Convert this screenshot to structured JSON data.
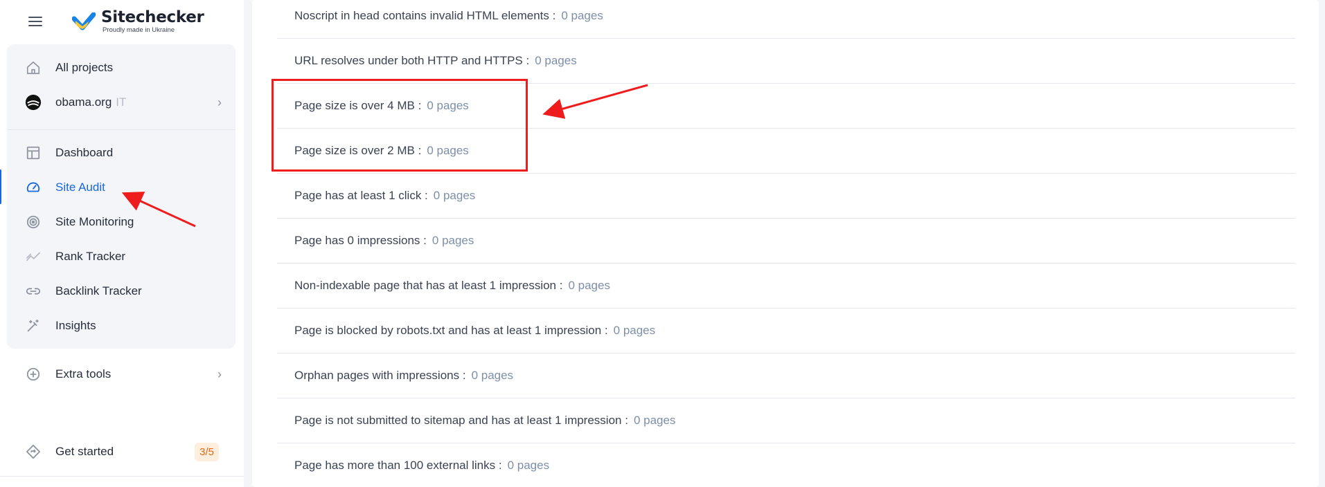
{
  "app": {
    "name": "Sitechecker",
    "tagline": "Proudly made in Ukraine"
  },
  "sidebar": {
    "all_projects": "All projects",
    "project": {
      "name": "obama.org",
      "tag": "IT"
    },
    "items": [
      {
        "label": "Dashboard",
        "icon": "dashboard-icon"
      },
      {
        "label": "Site Audit",
        "icon": "speedometer-icon",
        "active": true
      },
      {
        "label": "Site Monitoring",
        "icon": "radar-icon"
      },
      {
        "label": "Rank Tracker",
        "icon": "trend-icon"
      },
      {
        "label": "Backlink Tracker",
        "icon": "link-icon"
      },
      {
        "label": "Insights",
        "icon": "magic-wand-icon"
      }
    ],
    "extra_tools": "Extra tools",
    "get_started": {
      "label": "Get started",
      "progress": "3/5"
    }
  },
  "issues": [
    {
      "label": "Noscript in head contains invalid HTML elements :",
      "count": "0 pages"
    },
    {
      "label": "URL resolves under both HTTP and HTTPS :",
      "count": "0 pages"
    },
    {
      "label": "Page size is over 4 MB :",
      "count": "0 pages"
    },
    {
      "label": "Page size is over 2 MB :",
      "count": "0 pages"
    },
    {
      "label": "Page has at least 1 click :",
      "count": "0 pages"
    },
    {
      "label": "Page has 0 impressions :",
      "count": "0 pages"
    },
    {
      "label": "Non-indexable page that has at least 1 impression :",
      "count": "0 pages"
    },
    {
      "label": "Page is blocked by robots.txt and has at least 1 impression :",
      "count": "0 pages"
    },
    {
      "label": "Orphan pages with impressions :",
      "count": "0 pages"
    },
    {
      "label": "Page is not submitted to sitemap and has at least 1 impression :",
      "count": "0 pages"
    },
    {
      "label": "Page has more than 100 external links :",
      "count": "0 pages"
    }
  ],
  "colors": {
    "accent": "#1867e0",
    "annotation": "#ee1c1c",
    "badge_text": "#e06a1a",
    "badge_bg": "#fdeede"
  }
}
